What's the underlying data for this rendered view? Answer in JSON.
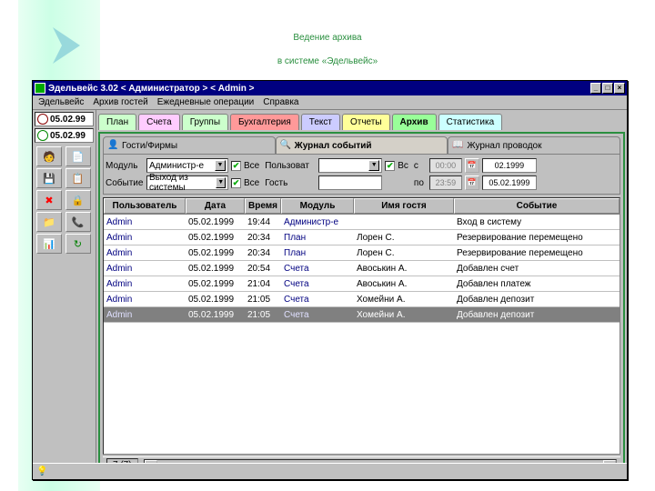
{
  "slide": {
    "title_line1": "Ведение архива",
    "title_line2": "в системе «Эдельвейс»"
  },
  "window": {
    "title": "Эдельвейс 3.02 < Администратор > < Admin >",
    "menu": [
      "Эдельвейс",
      "Архив гостей",
      "Ежедневные операции",
      "Справка"
    ],
    "dates": {
      "d1": "05.02.99",
      "d2": "05.02.99"
    }
  },
  "tabs": [
    {
      "label": "План",
      "cls": "lime"
    },
    {
      "label": "Счета",
      "cls": "pink"
    },
    {
      "label": "Группы",
      "cls": "lime"
    },
    {
      "label": "Бухгалтерия",
      "cls": "red"
    },
    {
      "label": "Текст",
      "cls": "blue"
    },
    {
      "label": "Отчеты",
      "cls": "yel"
    },
    {
      "label": "Архив",
      "cls": "grn"
    },
    {
      "label": "Статистика",
      "cls": "cyan"
    }
  ],
  "subtabs": {
    "a": "Гости/Фирмы",
    "b": "Журнал событий",
    "c": "Журнал проводок"
  },
  "filters": {
    "module_lbl": "Модуль",
    "module_val": "Администр-е",
    "event_lbl": "Событие",
    "event_val": "Выход из системы",
    "all_lbl": "Все",
    "user_lbl": "Пользоват",
    "guest_lbl": "Гость",
    "vs_lbl": "Вс",
    "from_lbl": "с",
    "to_lbl": "по",
    "from_time": "00:00",
    "to_time": "23:59",
    "from_date": "02.1999",
    "to_date": "05.02.1999"
  },
  "grid": {
    "headers": {
      "user": "Пользователь",
      "date": "Дата",
      "time": "Время",
      "module": "Модуль",
      "guest": "Имя гостя",
      "event": "Событие"
    },
    "rows": [
      {
        "user": "Admin",
        "date": "05.02.1999",
        "time": "19:44",
        "module": "Администр-е",
        "guest": "",
        "event": "Вход в систему"
      },
      {
        "user": "Admin",
        "date": "05.02.1999",
        "time": "20:34",
        "module": "План",
        "guest": "Лорен С.",
        "event": "Резервирование перемещено"
      },
      {
        "user": "Admin",
        "date": "05.02.1999",
        "time": "20:34",
        "module": "План",
        "guest": "Лорен С.",
        "event": "Резервирование перемещено"
      },
      {
        "user": "Admin",
        "date": "05.02.1999",
        "time": "20:54",
        "module": "Счета",
        "guest": "Авоськин А.",
        "event": "Добавлен счет"
      },
      {
        "user": "Admin",
        "date": "05.02.1999",
        "time": "21:04",
        "module": "Счета",
        "guest": "Авоськин А.",
        "event": "Добавлен платеж"
      },
      {
        "user": "Admin",
        "date": "05.02.1999",
        "time": "21:05",
        "module": "Счета",
        "guest": "Хомейни А.",
        "event": "Добавлен депозит"
      },
      {
        "user": "Admin",
        "date": "05.02.1999",
        "time": "21:05",
        "module": "Счета",
        "guest": "Хомейни А.",
        "event": "Добавлен депозит"
      }
    ],
    "selected": 6,
    "status": "7 (7)"
  }
}
